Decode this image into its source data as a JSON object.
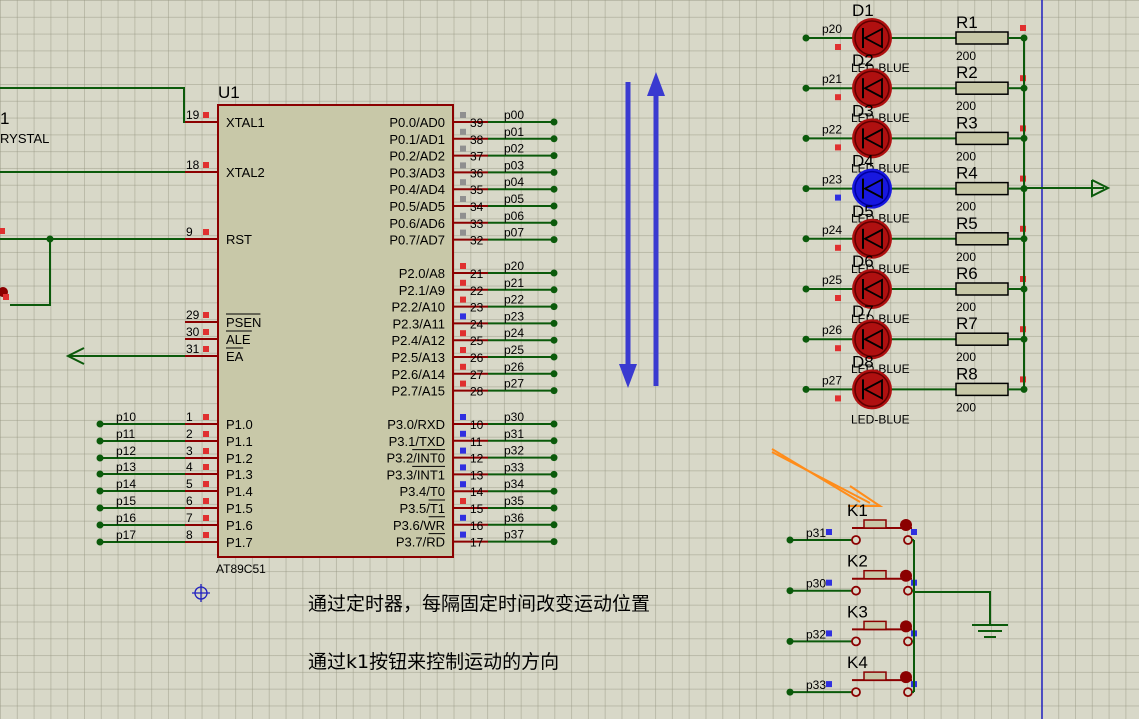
{
  "chip": {
    "ref": "U1",
    "part": "AT89C51",
    "left_pins": [
      {
        "num": "19",
        "name": "XTAL1"
      },
      {
        "num": "18",
        "name": "XTAL2"
      },
      {
        "num": "9",
        "name": "RST"
      },
      {
        "num": "29",
        "name": "PSEN"
      },
      {
        "num": "30",
        "name": "ALE"
      },
      {
        "num": "31",
        "name": "EA"
      },
      {
        "num": "1",
        "name": "P1.0",
        "net": "p10"
      },
      {
        "num": "2",
        "name": "P1.1",
        "net": "p11"
      },
      {
        "num": "3",
        "name": "P1.2",
        "net": "p12"
      },
      {
        "num": "4",
        "name": "P1.3",
        "net": "p13"
      },
      {
        "num": "5",
        "name": "P1.4",
        "net": "p14"
      },
      {
        "num": "6",
        "name": "P1.5",
        "net": "p15"
      },
      {
        "num": "7",
        "name": "P1.6",
        "net": "p16"
      },
      {
        "num": "8",
        "name": "P1.7",
        "net": "p17"
      }
    ],
    "right_pins": [
      {
        "num": "39",
        "name": "P0.0/AD0",
        "net": "p00"
      },
      {
        "num": "38",
        "name": "P0.1/AD1",
        "net": "p01"
      },
      {
        "num": "37",
        "name": "P0.2/AD2",
        "net": "p02"
      },
      {
        "num": "36",
        "name": "P0.3/AD3",
        "net": "p03"
      },
      {
        "num": "35",
        "name": "P0.4/AD4",
        "net": "p04"
      },
      {
        "num": "34",
        "name": "P0.5/AD5",
        "net": "p05"
      },
      {
        "num": "33",
        "name": "P0.6/AD6",
        "net": "p06"
      },
      {
        "num": "32",
        "name": "P0.7/AD7",
        "net": "p07"
      },
      {
        "num": "21",
        "name": "P2.0/A8",
        "net": "p20"
      },
      {
        "num": "22",
        "name": "P2.1/A9",
        "net": "p21"
      },
      {
        "num": "23",
        "name": "P2.2/A10",
        "net": "p22"
      },
      {
        "num": "24",
        "name": "P2.3/A11",
        "net": "p23"
      },
      {
        "num": "25",
        "name": "P2.4/A12",
        "net": "p24"
      },
      {
        "num": "26",
        "name": "P2.5/A13",
        "net": "p25"
      },
      {
        "num": "27",
        "name": "P2.6/A14",
        "net": "p26"
      },
      {
        "num": "28",
        "name": "P2.7/A15",
        "net": "p27"
      },
      {
        "num": "10",
        "name": "P3.0/RXD",
        "net": "p30"
      },
      {
        "num": "11",
        "name": "P3.1/TXD",
        "net": "p31"
      },
      {
        "num": "12",
        "name": "P3.2/INT0",
        "net": "p32"
      },
      {
        "num": "13",
        "name": "P3.3/INT1",
        "net": "p33"
      },
      {
        "num": "14",
        "name": "P3.4/T0",
        "net": "p34"
      },
      {
        "num": "15",
        "name": "P3.5/T1",
        "net": "p35"
      },
      {
        "num": "16",
        "name": "P3.6/WR",
        "net": "p36"
      },
      {
        "num": "17",
        "name": "P3.7/RD",
        "net": "p37"
      }
    ]
  },
  "crystal": {
    "ref": "1",
    "part": "RYSTAL"
  },
  "leds": [
    {
      "ref": "D1",
      "net": "p20",
      "part": "LED-BLUE",
      "lit": false
    },
    {
      "ref": "D2",
      "net": "p21",
      "part": "LED-BLUE",
      "lit": false
    },
    {
      "ref": "D3",
      "net": "p22",
      "part": "LED-BLUE",
      "lit": false
    },
    {
      "ref": "D4",
      "net": "p23",
      "part": "LED-BLUE",
      "lit": true
    },
    {
      "ref": "D5",
      "net": "p24",
      "part": "LED-BLUE",
      "lit": false
    },
    {
      "ref": "D6",
      "net": "p25",
      "part": "LED-BLUE",
      "lit": false
    },
    {
      "ref": "D7",
      "net": "p26",
      "part": "LED-BLUE",
      "lit": false
    },
    {
      "ref": "D8",
      "net": "p27",
      "part": "LED-BLUE",
      "lit": false
    }
  ],
  "resistors": [
    {
      "ref": "R1",
      "value": "200"
    },
    {
      "ref": "R2",
      "value": "200"
    },
    {
      "ref": "R3",
      "value": "200"
    },
    {
      "ref": "R4",
      "value": "200"
    },
    {
      "ref": "R5",
      "value": "200"
    },
    {
      "ref": "R6",
      "value": "200"
    },
    {
      "ref": "R7",
      "value": "200"
    },
    {
      "ref": "R8",
      "value": "200"
    }
  ],
  "buttons": [
    {
      "ref": "K1",
      "net": "p31"
    },
    {
      "ref": "K2",
      "net": "p30"
    },
    {
      "ref": "K3",
      "net": "p32"
    },
    {
      "ref": "K4",
      "net": "p33"
    }
  ],
  "notes": {
    "line1": "通过定时器，每隔固定时间改变运动位置",
    "line2": "通过k1按钮来控制运动的方向"
  },
  "colors": {
    "wire": "#0b5a0b",
    "pin": "#8b0000",
    "chip_fill": "#c8c8a8",
    "led_off": "#b01010",
    "led_on": "#1818e0",
    "arrow_blue": "#3a3ad0",
    "arrow_orange": "#ff8c1a",
    "sheet_border": "#2020c0"
  }
}
